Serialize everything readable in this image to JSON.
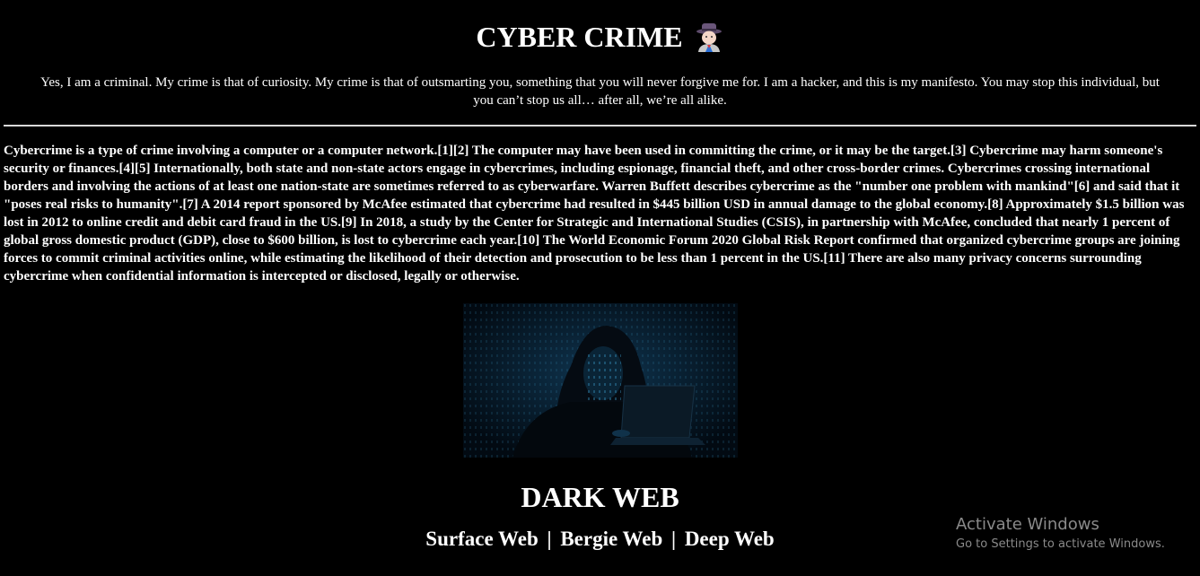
{
  "header": {
    "title": "CYBER CRIME",
    "title_icon": "detective-emoji-icon"
  },
  "quote": "Yes, I am a criminal. My crime is that of curiosity. My crime is that of outsmarting you, something that you will never forgive me for. I am a hacker, and this is my manifesto. You may stop this individual, but you can’t stop us all… after all, we’re all alike.",
  "article": "Cybercrime is a type of crime involving a computer or a computer network.[1][2] The computer may have been used in committing the crime, or it may be the target.[3] Cybercrime may harm someone's security or finances.[4][5] Internationally, both state and non-state actors engage in cybercrimes, including espionage, financial theft, and other cross-border crimes. Cybercrimes crossing international borders and involving the actions of at least one nation-state are sometimes referred to as cyberwarfare. Warren Buffett describes cybercrime as the \"number one problem with mankind\"[6] and said that it \"poses real risks to humanity\".[7] A 2014 report sponsored by McAfee estimated that cybercrime had resulted in $445 billion USD in annual damage to the global economy.[8] Approximately $1.5 billion was lost in 2012 to online credit and debit card fraud in the US.[9] In 2018, a study by the Center for Strategic and International Studies (CSIS), in partnership with McAfee, concluded that nearly 1 percent of global gross domestic product (GDP), close to $600 billion, is lost to cybercrime each year.[10] The World Economic Forum 2020 Global Risk Report confirmed that organized cybercrime groups are joining forces to commit criminal activities online, while estimating the likelihood of their detection and prosecution to be less than 1 percent in the US.[11] There are also many privacy concerns surrounding cybercrime when confidential information is intercepted or disclosed, legally or otherwise.",
  "hero_image": {
    "icon": "hooded-hacker-laptop-image"
  },
  "dark_web": {
    "title": "DARK WEB",
    "links": [
      {
        "label": "Surface Web"
      },
      {
        "label": "Bergie Web"
      },
      {
        "label": "Deep Web"
      }
    ],
    "separator": "|"
  },
  "watermark": {
    "title": "Activate Windows",
    "subtitle": "Go to Settings to activate Windows."
  }
}
